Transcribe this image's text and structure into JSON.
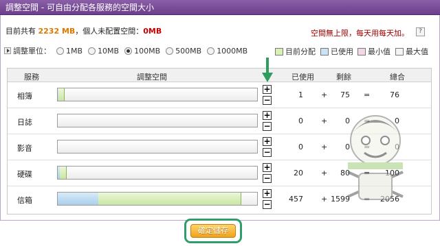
{
  "title": "調整空間 - 可自由分配各服務的空間大小",
  "info": {
    "prefix": "目前共有 ",
    "total": "2232 MB",
    "middle": "，個人未配置空間：",
    "unallocated": "0MB"
  },
  "notice": "空間無上限，每天用每天加。",
  "help_label": "?",
  "unit": {
    "label": "調整單位：",
    "options": [
      "1MB",
      "10MB",
      "100MB",
      "500MB",
      "1000MB"
    ],
    "selected": "100MB"
  },
  "legend": [
    {
      "label": "目前分配",
      "color": "#d8efb6"
    },
    {
      "label": "已使用",
      "color": "#c9e2f5"
    },
    {
      "label": "最小值",
      "color": "#f4d7e7"
    },
    {
      "label": "最大值",
      "color": "#f4f4f4"
    }
  ],
  "columns": {
    "service": "服務",
    "adjust": "調整空間",
    "used": "已使用",
    "remaining": "剩餘",
    "total": "總合"
  },
  "operators": {
    "plus": "+",
    "equals": "="
  },
  "buttons": {
    "plus": "+",
    "minus": "−"
  },
  "rows": [
    {
      "name": "相簿",
      "used": "1",
      "remaining": "75",
      "total": "76",
      "used_fraction": 0.005,
      "allocated_fraction": 0.034
    },
    {
      "name": "日誌",
      "used": "0",
      "remaining": "0",
      "total": "0",
      "used_fraction": 0,
      "allocated_fraction": 0
    },
    {
      "name": "影音",
      "used": "0",
      "remaining": "0",
      "total": "0",
      "used_fraction": 0,
      "allocated_fraction": 0
    },
    {
      "name": "硬碟",
      "used": "20",
      "remaining": "80",
      "total": "100",
      "used_fraction": 0.009,
      "allocated_fraction": 0.045
    },
    {
      "name": "信箱",
      "used": "457",
      "remaining": "1599",
      "total": "2056",
      "used_fraction": 0.205,
      "allocated_fraction": 0.921
    }
  ],
  "save_label": "確定儲存",
  "colors": {
    "title_bar": "#7a4c9a",
    "total_text": "#e07800",
    "unallocated_text": "#cc0000",
    "notice_text": "#a00000",
    "arrow": "#2f9d5f",
    "save_button": "#f5b133",
    "save_highlight": "#2f9d6a"
  }
}
